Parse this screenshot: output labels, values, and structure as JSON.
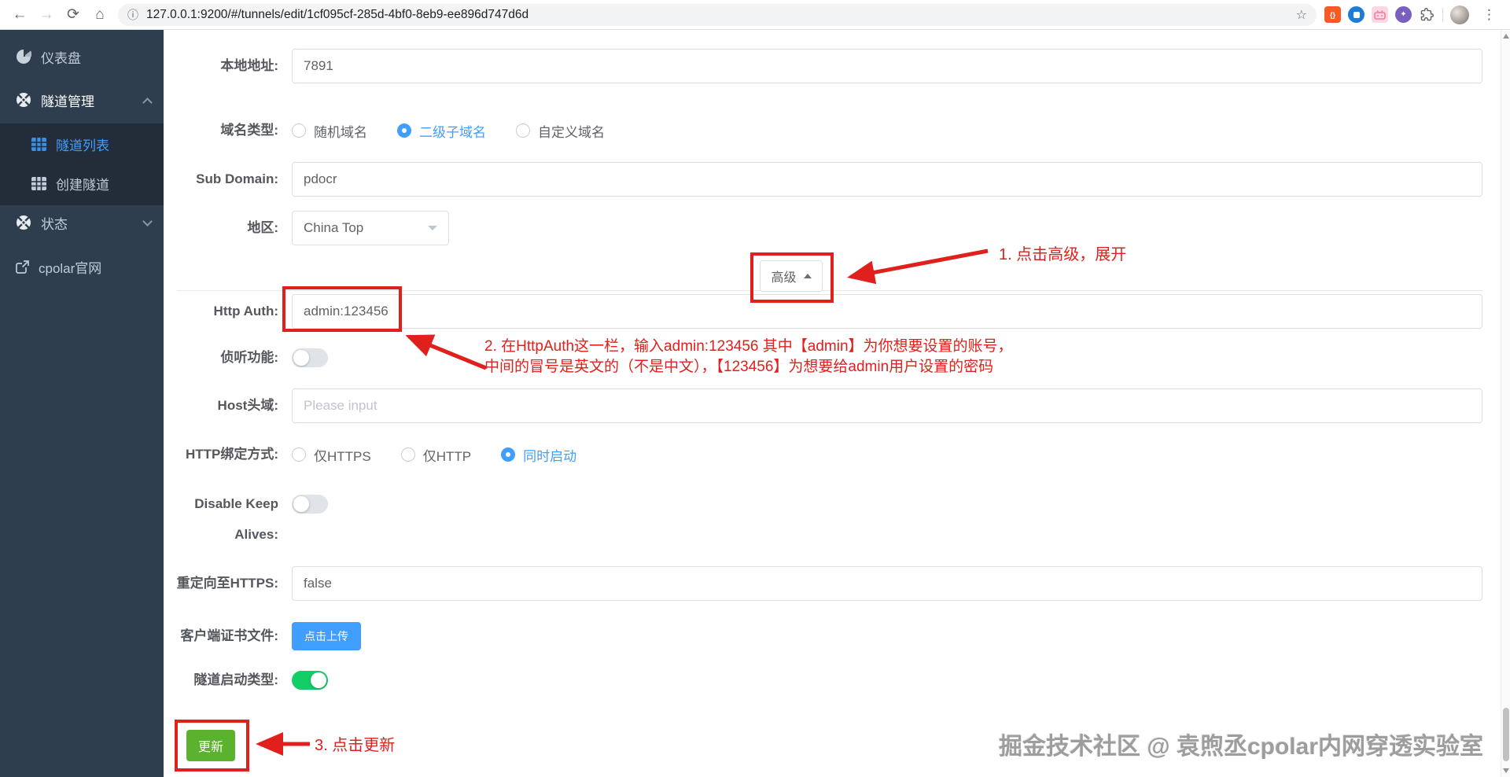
{
  "browser": {
    "url": "127.0.0.1:9200/#/tunnels/edit/1cf095cf-285d-4bf0-8eb9-ee896d747d6d"
  },
  "sidebar": {
    "items": [
      {
        "label": "仪表盘"
      },
      {
        "label": "隧道管理"
      },
      {
        "label": "隧道列表"
      },
      {
        "label": "创建隧道"
      },
      {
        "label": "状态"
      },
      {
        "label": "cpolar官网"
      }
    ]
  },
  "form": {
    "local_address": {
      "label": "本地地址:",
      "value": "7891"
    },
    "domain_type": {
      "label": "域名类型:",
      "options": [
        "随机域名",
        "二级子域名",
        "自定义域名"
      ],
      "selected": "二级子域名"
    },
    "sub_domain": {
      "label": "Sub Domain:",
      "value": "pdocr"
    },
    "region": {
      "label": "地区:",
      "value": "China Top"
    },
    "advanced_button": "高级",
    "http_auth": {
      "label": "Http Auth:",
      "value": "admin:123456"
    },
    "inspect": {
      "label": "侦听功能:",
      "state": "off"
    },
    "host_header": {
      "label": "Host头域:",
      "placeholder": "Please input"
    },
    "http_bind": {
      "label": "HTTP绑定方式:",
      "options": [
        "仅HTTPS",
        "仅HTTP",
        "同时启动"
      ],
      "selected": "同时启动"
    },
    "disable_keep_alives": {
      "label_line1": "Disable Keep",
      "label_line2": "Alives:",
      "state": "off"
    },
    "redirect_https": {
      "label": "重定向至HTTPS:",
      "value": "false"
    },
    "client_cert": {
      "label": "客户端证书文件:",
      "button": "点击上传"
    },
    "tunnel_start_type": {
      "label": "隧道启动类型:",
      "state": "on"
    },
    "update_button": "更新"
  },
  "annotations": {
    "step1": "1. 点击高级，展开",
    "step2_line1": "2. 在HttpAuth这一栏，输入admin:123456 其中【admin】为你想要设置的账号，",
    "step2_line2": "中间的冒号是英文的（不是中文），【123456】为想要给admin用户设置的密码",
    "step3": "3. 点击更新"
  },
  "watermark": "掘金技术社区 @ 袁煦丞cpolar内网穿透实验室",
  "colors": {
    "accent_blue": "#409eff",
    "toggle_green": "#13ce66",
    "update_green": "#5bb22e",
    "annotation_red": "#e0201c",
    "sidebar_bg": "#2f3e4e",
    "sidebar_submenu_bg": "#222d39"
  }
}
